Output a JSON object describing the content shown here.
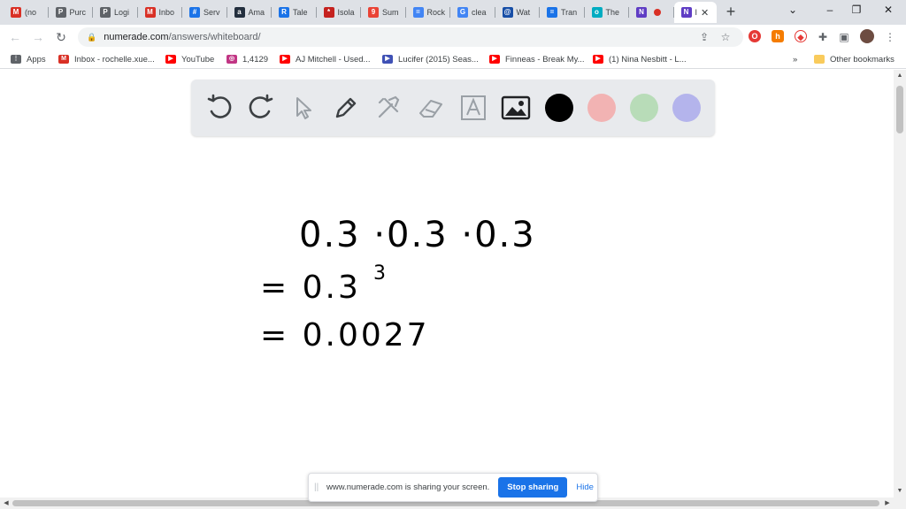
{
  "browser": {
    "tabs": [
      {
        "label": "(no",
        "icon": "gmail-icon",
        "color": "#d93025",
        "glyph": "M"
      },
      {
        "label": "Purc",
        "icon": "p-icon",
        "color": "#5f6368",
        "glyph": "P"
      },
      {
        "label": "Logi",
        "icon": "p-icon",
        "color": "#5f6368",
        "glyph": "P"
      },
      {
        "label": "Inbo",
        "icon": "gmail-icon",
        "color": "#d93025",
        "glyph": "M"
      },
      {
        "label": "Serv",
        "icon": "grid-icon",
        "color": "#1a73e8",
        "glyph": "#"
      },
      {
        "label": "Ama",
        "icon": "amazon-icon",
        "color": "#232f3e",
        "glyph": "a"
      },
      {
        "label": "Tale",
        "icon": "r-icon",
        "color": "#1a73e8",
        "glyph": "R"
      },
      {
        "label": "Isola",
        "icon": "atom-icon",
        "color": "#c5221f",
        "glyph": "*"
      },
      {
        "label": "Sum",
        "icon": "maps-icon",
        "color": "#ea4335",
        "glyph": "9"
      },
      {
        "label": "Rock",
        "icon": "docs-icon",
        "color": "#4285f4",
        "glyph": "="
      },
      {
        "label": "clea",
        "icon": "google-icon",
        "color": "#4285f4",
        "glyph": "G"
      },
      {
        "label": "Wat",
        "icon": "globe-icon",
        "color": "#174ea6",
        "glyph": "@"
      },
      {
        "label": "Tran",
        "icon": "tran-icon",
        "color": "#1a73e8",
        "glyph": "="
      },
      {
        "label": "The",
        "icon": "drop-icon",
        "color": "#00acc1",
        "glyph": "o"
      },
      {
        "label": "",
        "icon": "numerade-icon",
        "color": "#5f3dc4",
        "glyph": "N"
      },
      {
        "label": "I",
        "icon": "numerade-icon",
        "color": "#5f3dc4",
        "glyph": "N"
      }
    ],
    "new_tab": "+",
    "window_controls": {
      "minimize": "–",
      "restore": "❐",
      "close": "✕",
      "tabsearch": "⌄"
    },
    "nav": {
      "back": "←",
      "forward": "→",
      "reload": "↻"
    },
    "url_host": "numerade.com",
    "url_path": "/answers/whiteboard/",
    "bookmarks": [
      {
        "label": "Apps",
        "icon": "apps-icon",
        "color": "#5f6368",
        "glyph": "⋮"
      },
      {
        "label": "Inbox - rochelle.xue...",
        "icon": "gmail-icon",
        "color": "#d93025",
        "glyph": "M"
      },
      {
        "label": "YouTube",
        "icon": "youtube-icon",
        "color": "#ff0000",
        "glyph": "▶"
      },
      {
        "label": "1,4129",
        "icon": "instagram-icon",
        "color": "#c13584",
        "glyph": "◎"
      },
      {
        "label": "AJ Mitchell - Used...",
        "icon": "youtube-icon",
        "color": "#ff0000",
        "glyph": "▶"
      },
      {
        "label": "Lucifer (2015) Seas...",
        "icon": "play-icon",
        "color": "#3f51b5",
        "glyph": "▶"
      },
      {
        "label": "Finneas - Break My...",
        "icon": "youtube-icon",
        "color": "#ff0000",
        "glyph": "▶"
      },
      {
        "label": "(1) Nina Nesbitt - L...",
        "icon": "youtube-icon",
        "color": "#ff0000",
        "glyph": "▶"
      }
    ],
    "bookmarks_overflow": "»",
    "other_bookmarks": "Other bookmarks"
  },
  "whiteboard": {
    "tools": [
      "undo-icon",
      "redo-icon",
      "pointer-icon",
      "pen-icon",
      "tools-icon",
      "eraser-icon",
      "text-icon",
      "image-icon"
    ],
    "colors": [
      "#000000",
      "#f2b3b3",
      "#b8dcb8",
      "#b4b4ec"
    ],
    "handwriting": {
      "line1": "0.3 ·0.3 ·0.3",
      "line2_base": "= 0.3",
      "line2_exp": "3",
      "line3": "= 0.0027"
    }
  },
  "share_banner": {
    "message": "www.numerade.com is sharing your screen.",
    "stop_label": "Stop sharing",
    "hide_label": "Hide"
  }
}
